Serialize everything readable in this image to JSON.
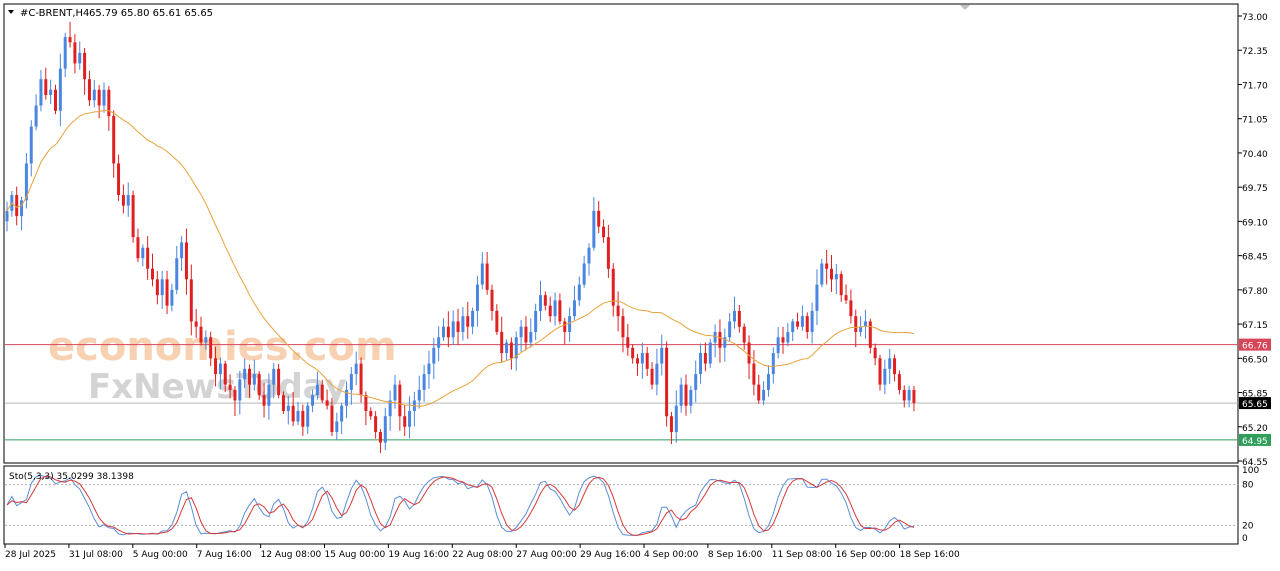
{
  "header": {
    "symbol": "#C-BRENT,H4",
    "ohlc": "65.79 65.80 65.61 65.65"
  },
  "watermark": {
    "line1": "economies.com",
    "line2": "FxNewsToday"
  },
  "colors": {
    "bull": "#4a86e0",
    "bear": "#e02020",
    "ma": "#e8a33a",
    "resistance_line": "#d64558",
    "support_line": "#2f9e5a",
    "current_line": "#b8b8b8",
    "stoch_main": "#5b8fd8",
    "stoch_signal": "#d83a3a"
  },
  "chart_data": [
    {
      "type": "candlestick",
      "title": "#C-BRENT,H4",
      "timeframe": "H4",
      "last_ohlc": {
        "open": 65.79,
        "high": 65.8,
        "low": 65.61,
        "close": 65.65
      },
      "ylim": [
        64.55,
        73.0
      ],
      "y_ticks": [
        "73.00",
        "72.35",
        "71.70",
        "71.05",
        "70.40",
        "69.75",
        "69.10",
        "68.45",
        "67.80",
        "67.15",
        "66.50",
        "65.85",
        "65.20",
        "64.55"
      ],
      "x_ticks": [
        "28 Jul 2025",
        "31 Jul 08:00",
        "5 Aug 00:00",
        "7 Aug 16:00",
        "12 Aug 08:00",
        "15 Aug 00:00",
        "19 Aug 16:00",
        "22 Aug 08:00",
        "27 Aug 00:00",
        "29 Aug 16:00",
        "4 Sep 00:00",
        "8 Sep 16:00",
        "11 Sep 08:00",
        "16 Sep 00:00",
        "18 Sep 16:00"
      ],
      "grid": false,
      "price_labels": [
        {
          "name": "resistance",
          "value": 66.76,
          "label": "66.76"
        },
        {
          "name": "current",
          "value": 65.65,
          "label": "65.65"
        },
        {
          "name": "support",
          "value": 64.95,
          "label": "64.95"
        }
      ],
      "closes": [
        69.3,
        69.6,
        69.2,
        69.5,
        70.2,
        70.9,
        71.3,
        71.8,
        71.5,
        71.6,
        71.2,
        72.0,
        72.6,
        72.5,
        72.1,
        72.3,
        71.8,
        71.4,
        71.6,
        71.3,
        71.6,
        71.1,
        70.2,
        69.6,
        69.4,
        69.6,
        68.8,
        68.4,
        68.6,
        68.2,
        68.0,
        67.7,
        68.0,
        67.5,
        67.8,
        68.4,
        68.7,
        68.0,
        67.2,
        67.1,
        66.8,
        66.9,
        66.5,
        66.2,
        66.4,
        66.0,
        65.9,
        65.7,
        66.1,
        66.3,
        66.0,
        66.2,
        65.8,
        65.6,
        66.0,
        66.3,
        65.8,
        65.5,
        65.6,
        65.3,
        65.5,
        65.2,
        65.6,
        65.8,
        66.0,
        65.7,
        65.6,
        65.1,
        65.3,
        65.6,
        65.9,
        66.2,
        66.4,
        65.8,
        65.5,
        65.4,
        65.1,
        64.9,
        65.4,
        65.7,
        66.0,
        65.4,
        65.2,
        65.5,
        65.7,
        65.9,
        66.2,
        66.4,
        66.7,
        66.9,
        67.1,
        66.9,
        67.2,
        67.0,
        67.3,
        67.1,
        67.4,
        67.9,
        68.3,
        67.8,
        67.4,
        67.0,
        66.6,
        66.8,
        66.5,
        66.9,
        67.1,
        66.8,
        67.0,
        67.4,
        67.7,
        67.5,
        67.3,
        67.6,
        67.2,
        67.0,
        67.3,
        67.6,
        67.9,
        68.3,
        68.6,
        69.3,
        69.0,
        68.8,
        68.2,
        67.5,
        67.3,
        66.9,
        66.7,
        66.5,
        66.4,
        66.6,
        66.3,
        66.0,
        66.4,
        66.7,
        65.4,
        65.1,
        65.6,
        66.0,
        65.6,
        65.9,
        66.2,
        66.6,
        66.4,
        66.8,
        67.0,
        66.7,
        66.9,
        67.2,
        67.4,
        67.1,
        66.8,
        66.4,
        66.0,
        65.7,
        65.9,
        66.2,
        66.6,
        66.9,
        66.8,
        67.0,
        67.2,
        67.1,
        67.3,
        67.0,
        67.4,
        67.9,
        68.3,
        68.2,
        68.0,
        68.1,
        67.7,
        67.6,
        67.3,
        67.0,
        67.1,
        67.2,
        66.7,
        66.5,
        66.0,
        66.3,
        66.5,
        66.2,
        65.9,
        65.7,
        65.9,
        65.65
      ],
      "series": [
        {
          "name": "Sto(5,3,3)",
          "values": [
            35.0299
          ]
        },
        {
          "name": "Sto signal",
          "values": [
            38.1398
          ]
        }
      ],
      "stochastic": {
        "label": "Sto(5,3,3) 35.0299 38.1398",
        "levels": [
          "100",
          "80",
          "20",
          "0"
        ],
        "ylim": [
          0,
          100
        ]
      }
    }
  ]
}
